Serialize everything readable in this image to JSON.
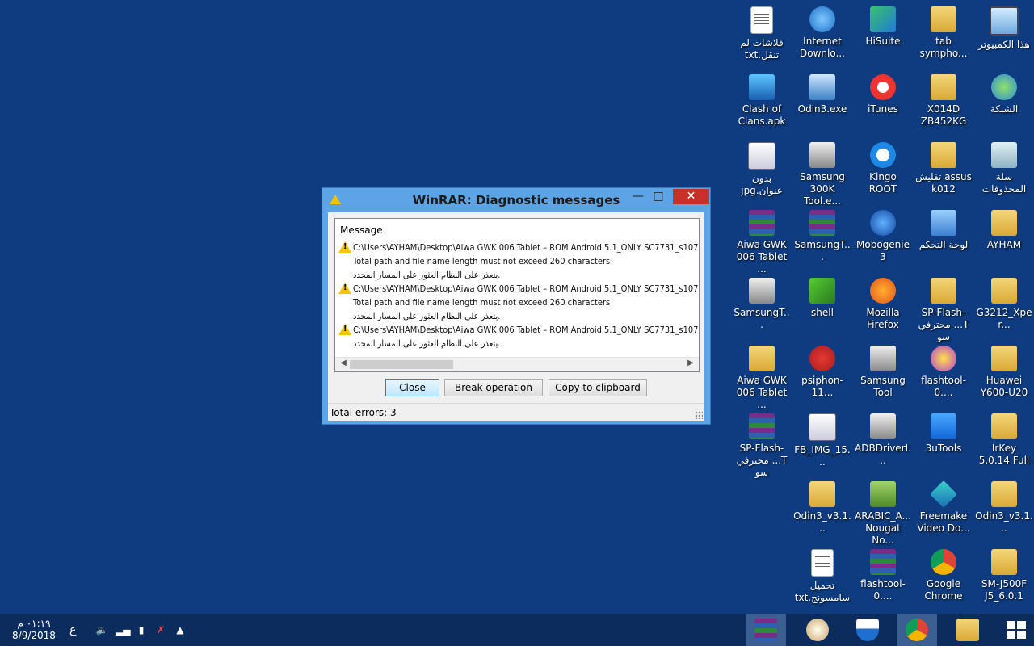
{
  "desktop_icons": [
    {
      "label": "هذا الكمبيوتر",
      "icon": "computer-icon"
    },
    {
      "label": "tab sympho...",
      "icon": "folder-icon"
    },
    {
      "label": "HiSuite",
      "icon": "hisuite-icon"
    },
    {
      "label": "Internet Downlo...",
      "icon": "internet-download-manager-icon"
    },
    {
      "label": "قلاشات لم تنقل.txt",
      "icon": "text-file-icon"
    },
    {
      "label": "الشبكة",
      "icon": "network-icon"
    },
    {
      "label": "X014D ZB452KG",
      "icon": "folder-icon"
    },
    {
      "label": "iTunes",
      "icon": "itunes-icon"
    },
    {
      "label": "Odin3.exe",
      "icon": "odin-icon"
    },
    {
      "label": "Clash of Clans.apk",
      "icon": "apk-icon"
    },
    {
      "label": "سلة المحذوفات",
      "icon": "recycle-bin-icon"
    },
    {
      "label": "assus تفليش k012",
      "icon": "folder-icon"
    },
    {
      "label": "Kingo ROOT",
      "icon": "kingo-root-icon"
    },
    {
      "label": "Samsung 300K Tool.e...",
      "icon": "tool-icon"
    },
    {
      "label": "بدون عنوان.jpg",
      "icon": "image-file-icon"
    },
    {
      "label": "AYHAM",
      "icon": "user-folder-icon"
    },
    {
      "label": "لوحة التحكم",
      "icon": "control-panel-icon"
    },
    {
      "label": "Mobogenie3",
      "icon": "mobogenie-icon"
    },
    {
      "label": "SamsungT...",
      "icon": "winrar-archive-icon"
    },
    {
      "label": "Aiwa GWK 006 Tablet ...",
      "icon": "winrar-archive-icon"
    },
    {
      "label": "G3212_Xper...",
      "icon": "folder-icon"
    },
    {
      "label": "SP-Flash-T... محترفي سو",
      "icon": "folder-icon"
    },
    {
      "label": "Mozilla Firefox",
      "icon": "firefox-icon"
    },
    {
      "label": "shell",
      "icon": "shell-icon"
    },
    {
      "label": "SamsungT...",
      "icon": "tool-icon"
    },
    {
      "label": "Huawei Y600-U20",
      "icon": "folder-icon"
    },
    {
      "label": "flashtool-0....",
      "icon": "flashtool-icon"
    },
    {
      "label": "Samsung Tool",
      "icon": "tool-icon"
    },
    {
      "label": "psiphon-11...",
      "icon": "psiphon-icon"
    },
    {
      "label": "Aiwa GWK 006 Tablet ...",
      "icon": "folder-icon"
    },
    {
      "label": "IrKey 5.0.14 Full",
      "icon": "zip-folder-icon"
    },
    {
      "label": "3uTools",
      "icon": "3utools-icon"
    },
    {
      "label": "ADBDriverI...",
      "icon": "adb-driver-icon"
    },
    {
      "label": "FB_IMG_15...",
      "icon": "image-file-icon"
    },
    {
      "label": "SP-Flash-T... محترفي سو",
      "icon": "winrar-archive-icon"
    },
    {
      "label": "Odin3_v3.1...",
      "icon": "zip-folder-icon"
    },
    {
      "label": "Freemake Video Do...",
      "icon": "freemake-icon"
    },
    {
      "label": "ARABIC_A... Nougat No...",
      "icon": "arabic-icon"
    },
    {
      "label": "Odin3_v3.1...",
      "icon": "zip-folder-icon"
    },
    {
      "label": "SM-J500F J5_6.0.1",
      "icon": "folder-icon"
    },
    {
      "label": "Google Chrome",
      "icon": "chrome-icon"
    },
    {
      "label": "flashtool-0....",
      "icon": "winrar-archive-icon"
    },
    {
      "label": "تحميل سامسونج.txt",
      "icon": "text-file-icon"
    }
  ],
  "dialog": {
    "title": "WinRAR: Diagnostic messages",
    "column_header": "Message",
    "messages": [
      {
        "path": "C:\\Users\\AYHAM\\Desktop\\Aiwa GWK 006 Tablet – ROM Android 5.1_ONLY SC7731_s107",
        "detail": "Total path and file name length must not exceed 260 characters",
        "arabic": "يتعذر على النظام العثور على المسار المحدد."
      },
      {
        "path": "C:\\Users\\AYHAM\\Desktop\\Aiwa GWK 006 Tablet – ROM Android 5.1_ONLY SC7731_s107",
        "detail": "Total path and file name length must not exceed 260 characters",
        "arabic": "يتعذر على النظام العثور على المسار المحدد."
      },
      {
        "path": "C:\\Users\\AYHAM\\Desktop\\Aiwa GWK 006 Tablet – ROM Android 5.1_ONLY SC7731_s107",
        "detail": "",
        "arabic": "يتعذر على النظام العثور على المسار المحدد."
      }
    ],
    "buttons": {
      "close": "Close",
      "break": "Break operation",
      "copy": "Copy to clipboard"
    },
    "status": "Total errors: 3"
  },
  "taskbar": {
    "time": "٠١:١٩ م",
    "date": "8/9/2018",
    "language": "ع"
  }
}
